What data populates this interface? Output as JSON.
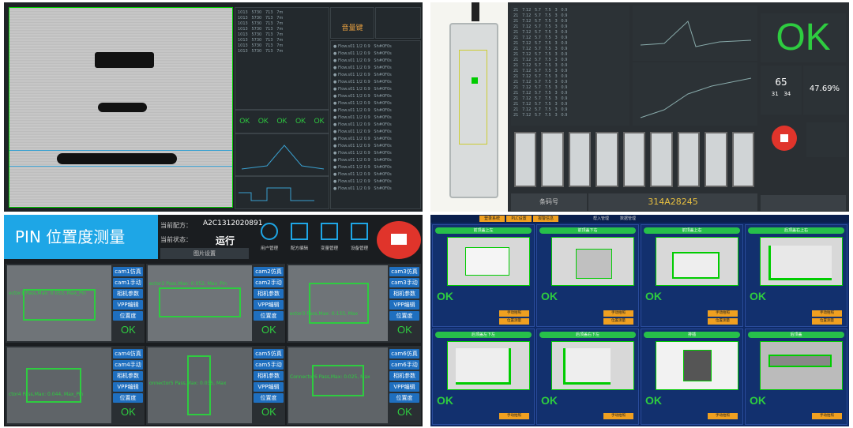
{
  "q1": {
    "pass_title": "音量键",
    "ok_labels": [
      "OK",
      "OK",
      "OK",
      "OK",
      "OK"
    ]
  },
  "q2": {
    "ok_big": "OK",
    "count": "65",
    "percent": "47.69%",
    "small_a": "31",
    "small_b": "34",
    "barcode": "314A28245",
    "tab_left": "条码号"
  },
  "q3": {
    "title": "PIN 位置度测量",
    "formula_label": "当前配方：",
    "formula_value": "A2C1312020891",
    "status_label": "当前状态：",
    "status_value": "运行",
    "image_setting": "图片设置",
    "menu": [
      "用户管理",
      "配方编辑",
      "变量管理",
      "设备管理"
    ],
    "cams": [
      {
        "sim": "cam1仿真",
        "manual": "cam1手动",
        "param": "相机参数",
        "vpp": "VPP编辑",
        "pos": "位置度",
        "overlay": "ector1 Pass,Max: 0.053, Max_Pin"
      },
      {
        "sim": "cam2仿真",
        "manual": "cam2手动",
        "param": "相机参数",
        "vpp": "VPP编辑",
        "pos": "位置度",
        "overlay": "ector2 Pass,Max: 0.052, Max_Pin"
      },
      {
        "sim": "cam3仿真",
        "manual": "cam3手动",
        "param": "相机参数",
        "vpp": "VPP编辑",
        "pos": "位置度",
        "overlay": "ector3 Pass,Max: 0.133, Max"
      },
      {
        "sim": "cam4仿真",
        "manual": "cam4手动",
        "param": "相机参数",
        "vpp": "VPP编辑",
        "pos": "位置度",
        "overlay": "ctor4 Pass,Max: 0.044, Max_Pin"
      },
      {
        "sim": "cam5仿真",
        "manual": "cam5手动",
        "param": "相机参数",
        "vpp": "VPP编辑",
        "pos": "位置度",
        "overlay": "onnector5 Pass,Max: 0.035, Max"
      },
      {
        "sim": "cam6仿真",
        "manual": "cam6手动",
        "param": "相机参数",
        "vpp": "VPP编辑",
        "pos": "位置度",
        "overlay": "Connector6 Pass,Max: 0.025, Max"
      }
    ],
    "ok": "OK"
  },
  "q4": {
    "top_tabs": [
      "登录系统",
      "PLC设置",
      "报警信息"
    ],
    "top_right": [
      "帮入管理",
      "数据管理"
    ],
    "cells": [
      {
        "title": "前顶盖上左",
        "ok": "OK",
        "b1": "手动拍照",
        "b2": "位置测量"
      },
      {
        "title": "前顶盖下右",
        "ok": "OK",
        "b1": "手动拍照",
        "b2": "位置测量"
      },
      {
        "title": "前顶盖上右",
        "ok": "OK",
        "b1": "手动拍照",
        "b2": "位置测量"
      },
      {
        "title": "后顶盖右上右",
        "ok": "OK",
        "b1": "手动拍照",
        "b2": "位置测量"
      },
      {
        "title": "后顶盖左下左",
        "ok": "OK",
        "b1": "手动拍照"
      },
      {
        "title": "后顶盖右下左",
        "ok": "OK",
        "b1": "手动拍照"
      },
      {
        "title": "排插",
        "ok": "OK",
        "b1": "手动拍照"
      },
      {
        "title": "后顶盖",
        "ok": "OK",
        "b1": "手动拍照"
      }
    ]
  }
}
